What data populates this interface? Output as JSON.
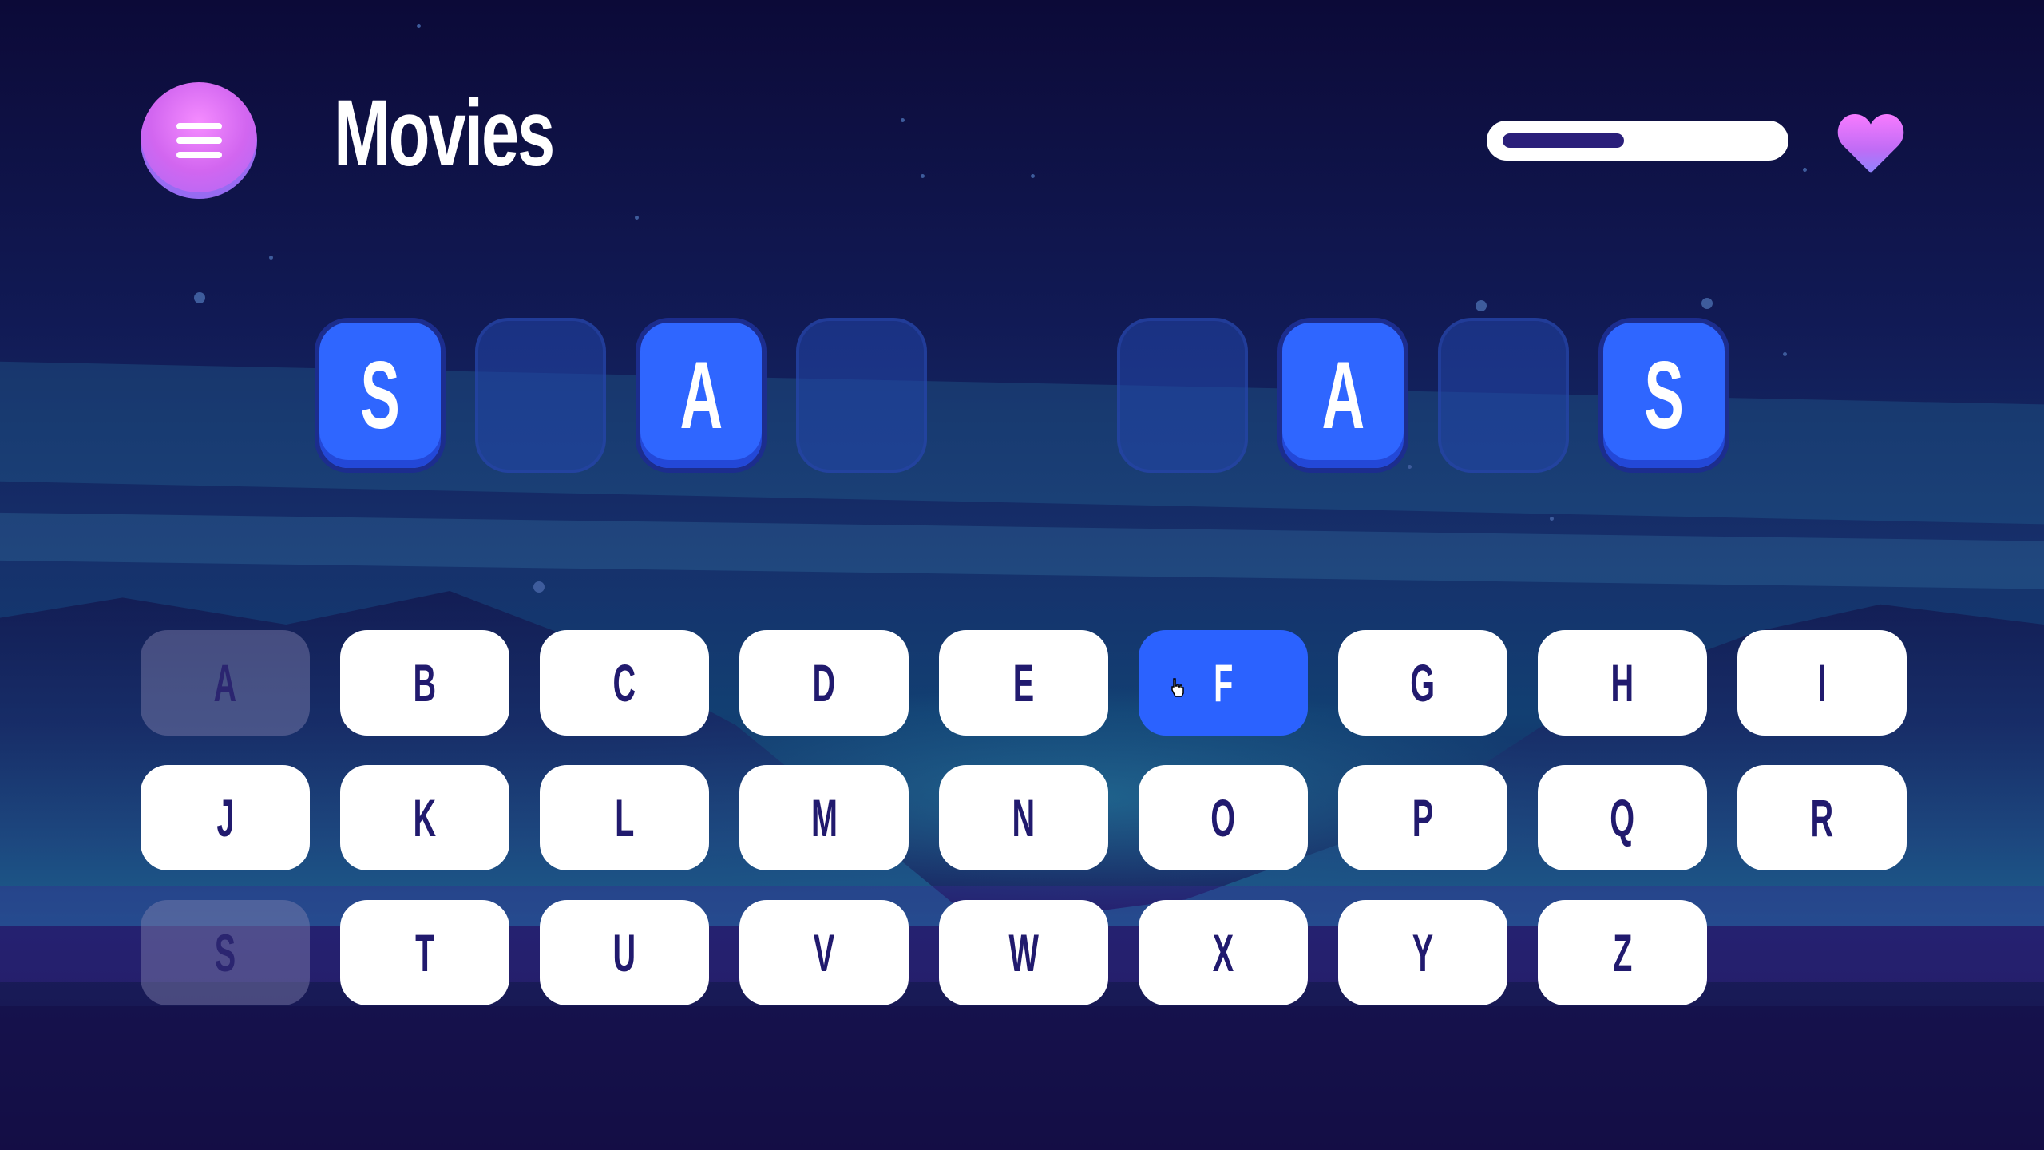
{
  "header": {
    "title": "Movies",
    "menu_icon": "hamburger-icon",
    "progress_fraction": 0.45,
    "lives_icon": "heart-icon"
  },
  "puzzle": {
    "slots": [
      {
        "letter": "S",
        "revealed": true
      },
      {
        "letter": "",
        "revealed": false
      },
      {
        "letter": "A",
        "revealed": true
      },
      {
        "letter": "",
        "revealed": false
      },
      null,
      {
        "letter": "",
        "revealed": false
      },
      {
        "letter": "A",
        "revealed": true
      },
      {
        "letter": "",
        "revealed": false
      },
      {
        "letter": "S",
        "revealed": true
      }
    ]
  },
  "keyboard": {
    "rows": [
      [
        "A",
        "B",
        "C",
        "D",
        "E",
        "F",
        "G",
        "H",
        "I"
      ],
      [
        "J",
        "K",
        "L",
        "M",
        "N",
        "O",
        "P",
        "Q",
        "R"
      ],
      [
        "S",
        "T",
        "U",
        "V",
        "W",
        "X",
        "Y",
        "Z"
      ]
    ],
    "used": [
      "A",
      "S"
    ],
    "highlighted": "F"
  },
  "colors": {
    "accent": "#2f66ff",
    "key_text": "#211a6e",
    "menu_pink": "#f58cff",
    "background": "#0d0b3a"
  }
}
